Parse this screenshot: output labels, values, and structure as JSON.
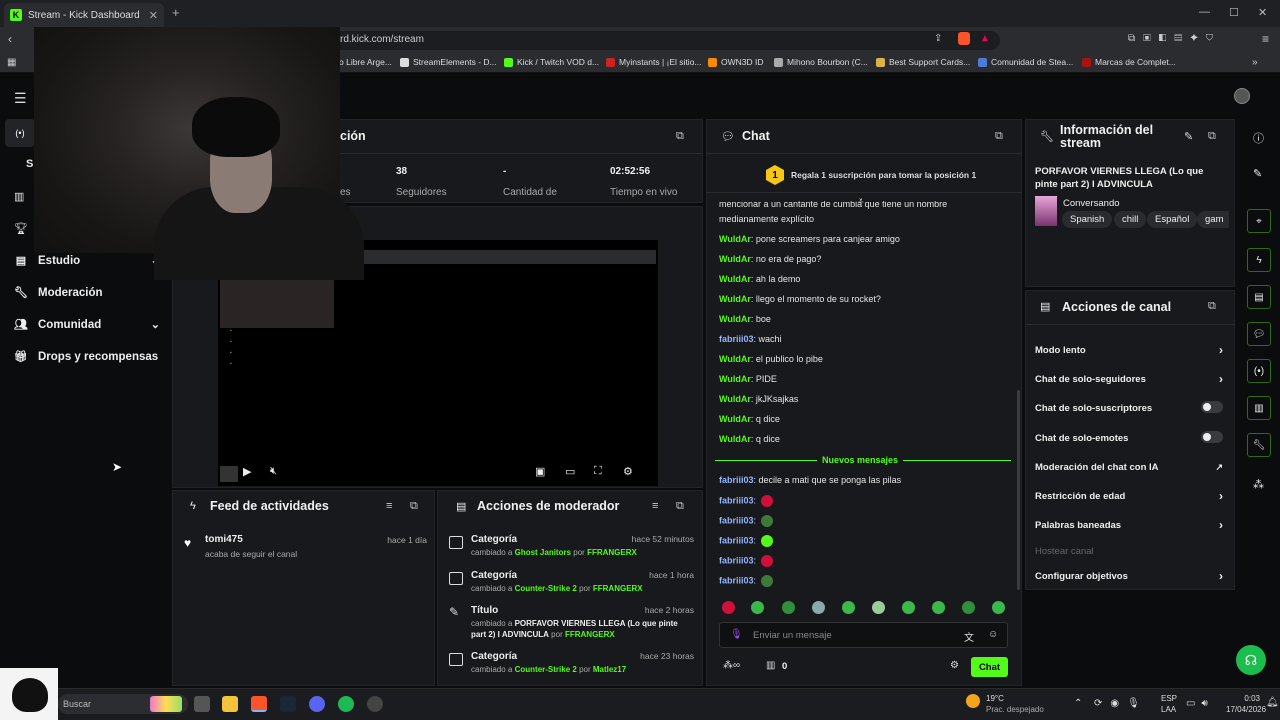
{
  "browser": {
    "tab_title": "Stream - Kick Dashboard",
    "url": "rd.kick.com/stream",
    "bookmarks": [
      "o Libre Arge...",
      "StreamElements - D...",
      "Kick / Twitch VOD d...",
      "Myinstants | ¡El sitio...",
      "OWN3D ID",
      "Mihono Bourbon (C...",
      "Best Support Cards...",
      "Comunidad de Stea...",
      "Marcas de Complet..."
    ]
  },
  "sidebar": {
    "partial_s": "S",
    "items": [
      {
        "label": "Estudio",
        "icon": "studio-icon",
        "expandable": true
      },
      {
        "label": "Moderación",
        "icon": "wrench-icon",
        "expandable": false
      },
      {
        "label": "Comunidad",
        "icon": "community-icon",
        "expandable": true
      },
      {
        "label": "Drops y recompensas",
        "icon": "drops-icon",
        "expandable": false
      }
    ]
  },
  "stats": {
    "title_partial": "ción",
    "partial_label": "es",
    "items": [
      {
        "value": "38",
        "label": "Seguidores"
      },
      {
        "value": "-",
        "label": "Cantidad de"
      },
      {
        "value": "02:52:56",
        "label": "Tiempo en vivo"
      }
    ],
    "stream_title_partial": "n"
  },
  "feed": {
    "title": "Feed de actividades",
    "items": [
      {
        "user": "tomi475",
        "text": "acaba de seguir el canal",
        "time": "hace 1 día"
      }
    ]
  },
  "mod_actions": {
    "title": "Acciones de moderador",
    "items": [
      {
        "type": "Categoría",
        "time": "hace 52 minutos",
        "prefix": "cambiado a",
        "value": "Ghost Janitors",
        "by": "por",
        "user": "FFRANGERX"
      },
      {
        "type": "Categoría",
        "time": "hace 1 hora",
        "prefix": "cambiado a",
        "value": "Counter-Strike 2",
        "by": "por",
        "user": "FFRANGERX"
      },
      {
        "type": "Título",
        "time": "hace 2 horas",
        "prefix": "cambiado a",
        "value": "PORFAVOR VIERNES LLEGA (Lo que pinte part 2) I ADVINCULA",
        "by": "por",
        "user": "FFRANGERX"
      },
      {
        "type": "Categoría",
        "time": "hace 23 horas",
        "prefix": "cambiado a",
        "value": "Counter-Strike 2",
        "by": "por",
        "user": "Matlez17"
      }
    ]
  },
  "chat": {
    "title": "Chat",
    "sub_gift_rank": "1",
    "sub_gift_text": "Regala 1 suscripción para tomar la posición 1",
    "clipped_line_1": "mencionar a un cantante de cumbia que tiene un nombre",
    "clipped_line_2": "medianamente explícito",
    "messages": [
      {
        "user": "WuldAr",
        "text": "pone screamers para canjear amigo"
      },
      {
        "user": "WuldAr",
        "text": "no era de pago?"
      },
      {
        "user": "WuldAr",
        "text": "ah la demo"
      },
      {
        "user": "WuldAr",
        "text": "llego el momento de su rocket?"
      },
      {
        "user": "WuldAr",
        "text": "boe"
      },
      {
        "user": "fabriii03",
        "text": "wachi"
      },
      {
        "user": "WuldAr",
        "text": "el publico lo pibe"
      },
      {
        "user": "WuldAr",
        "text": "PIDE"
      },
      {
        "user": "WuldAr",
        "text": "jkJKsajkas"
      },
      {
        "user": "WuldAr",
        "text": "q dice"
      },
      {
        "user": "WuldAr",
        "text": "q dice"
      }
    ],
    "new_messages_label": "Nuevos mensajes",
    "new_messages": [
      {
        "user": "fabriii03",
        "text": "decile a mati que se ponga las pilas"
      },
      {
        "user": "fabriii03",
        "text": "",
        "emote": "#d0103a"
      },
      {
        "user": "fabriii03",
        "text": "",
        "emote": "#3d7a3a"
      },
      {
        "user": "fabriii03",
        "text": "",
        "emote": "#53fc18"
      },
      {
        "user": "fabriii03",
        "text": "",
        "emote": "#d0103a"
      },
      {
        "user": "fabriii03",
        "text": "",
        "emote": "#3d7a3a"
      }
    ],
    "input_placeholder": "Enviar un mensaje",
    "points": "0",
    "send_label": "Chat"
  },
  "stream_info": {
    "title": "Información del stream",
    "stream_title": "PORFAVOR VIERNES LLEGA (Lo que pinte part 2) I ADVINCULA",
    "category": "Conversando",
    "tags": [
      "Spanish",
      "chill",
      "Español",
      "gam"
    ]
  },
  "channel_actions": {
    "title": "Acciones de canal",
    "items": [
      {
        "label": "Modo lento",
        "control": "arrow"
      },
      {
        "label": "Chat de solo-seguidores",
        "control": "arrow"
      },
      {
        "label": "Chat de solo-suscriptores",
        "control": "toggle"
      },
      {
        "label": "Chat de solo-emotes",
        "control": "toggle"
      },
      {
        "label": "Moderación del chat con IA",
        "control": "external"
      },
      {
        "label": "Restricción de edad",
        "control": "arrow"
      },
      {
        "label": "Palabras baneadas",
        "control": "arrow"
      },
      {
        "label": "Hostear canal",
        "control": "disabled"
      },
      {
        "label": "Configurar objetivos",
        "control": "arrow"
      }
    ]
  },
  "taskbar": {
    "search": "Buscar",
    "weather_temp": "19°C",
    "weather_desc": "Prac. despejado",
    "lang": "ESP",
    "region": "LAA",
    "time": "0:03",
    "date": "17/04/2026"
  },
  "colors": {
    "accent": "#53fc18",
    "panel": "#18191c",
    "background": "#0b0c0d"
  }
}
